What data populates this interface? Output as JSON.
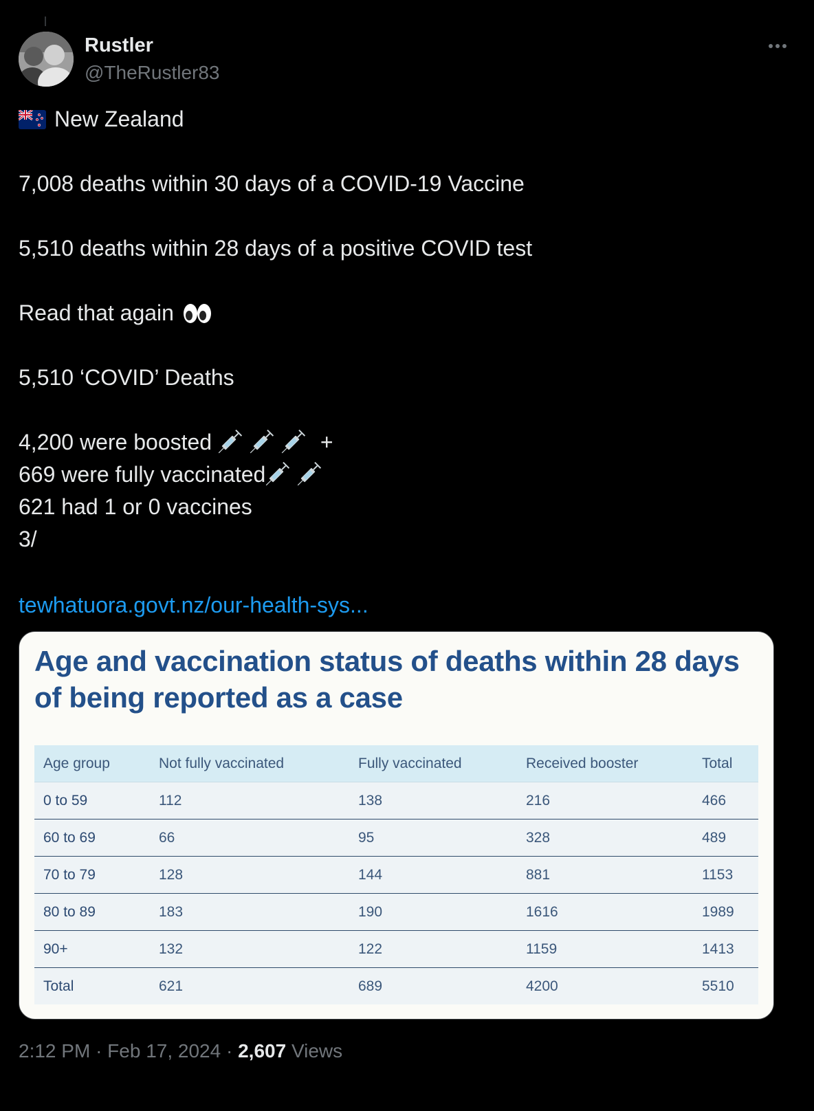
{
  "author": {
    "name": "Rustler",
    "handle": "@TheRustler83"
  },
  "tweet": {
    "flag_icon": "new-zealand-flag",
    "country": "New Zealand",
    "line_vaccine_deaths": "7,008 deaths within 30 days of a COVID-19 Vaccine",
    "line_covid_deaths": "5,510 deaths within 28 days of a positive COVID test",
    "line_read_again": "Read that again",
    "eyes_icon": "eyes-emoji",
    "line_covid_total": "5,510 ‘COVID’ Deaths",
    "line_boosted": "4,200 were boosted",
    "line_boosted_suffix": "+",
    "line_fully": "669 were fully vaccinated",
    "line_partial": "621 had 1 or 0 vaccines",
    "line_thread": "3/",
    "link": "tewhatuora.govt.nz/our-health-sys..."
  },
  "card": {
    "title": "Age and vaccination status of deaths within 28 days of being reported as a case",
    "columns": [
      "Age group",
      "Not fully vaccinated",
      "Fully vaccinated",
      "Received booster",
      "Total"
    ],
    "rows": [
      [
        "0 to 59",
        "112",
        "138",
        "216",
        "466"
      ],
      [
        "60 to 69",
        "66",
        "95",
        "328",
        "489"
      ],
      [
        "70 to 79",
        "128",
        "144",
        "881",
        "1153"
      ],
      [
        "80 to 89",
        "183",
        "190",
        "1616",
        "1989"
      ],
      [
        "90+",
        "132",
        "122",
        "1159",
        "1413"
      ],
      [
        "Total",
        "621",
        "689",
        "4200",
        "5510"
      ]
    ]
  },
  "footer": {
    "time": "2:12 PM",
    "separator": "·",
    "date": "Feb 17, 2024",
    "views_count": "2,607",
    "views_label": "Views"
  },
  "colors": {
    "background": "#000000",
    "text": "#e7e9ea",
    "muted": "#71767b",
    "link": "#1d9bf0",
    "card_title": "#23508a",
    "table_header": "#d6ecf4"
  }
}
